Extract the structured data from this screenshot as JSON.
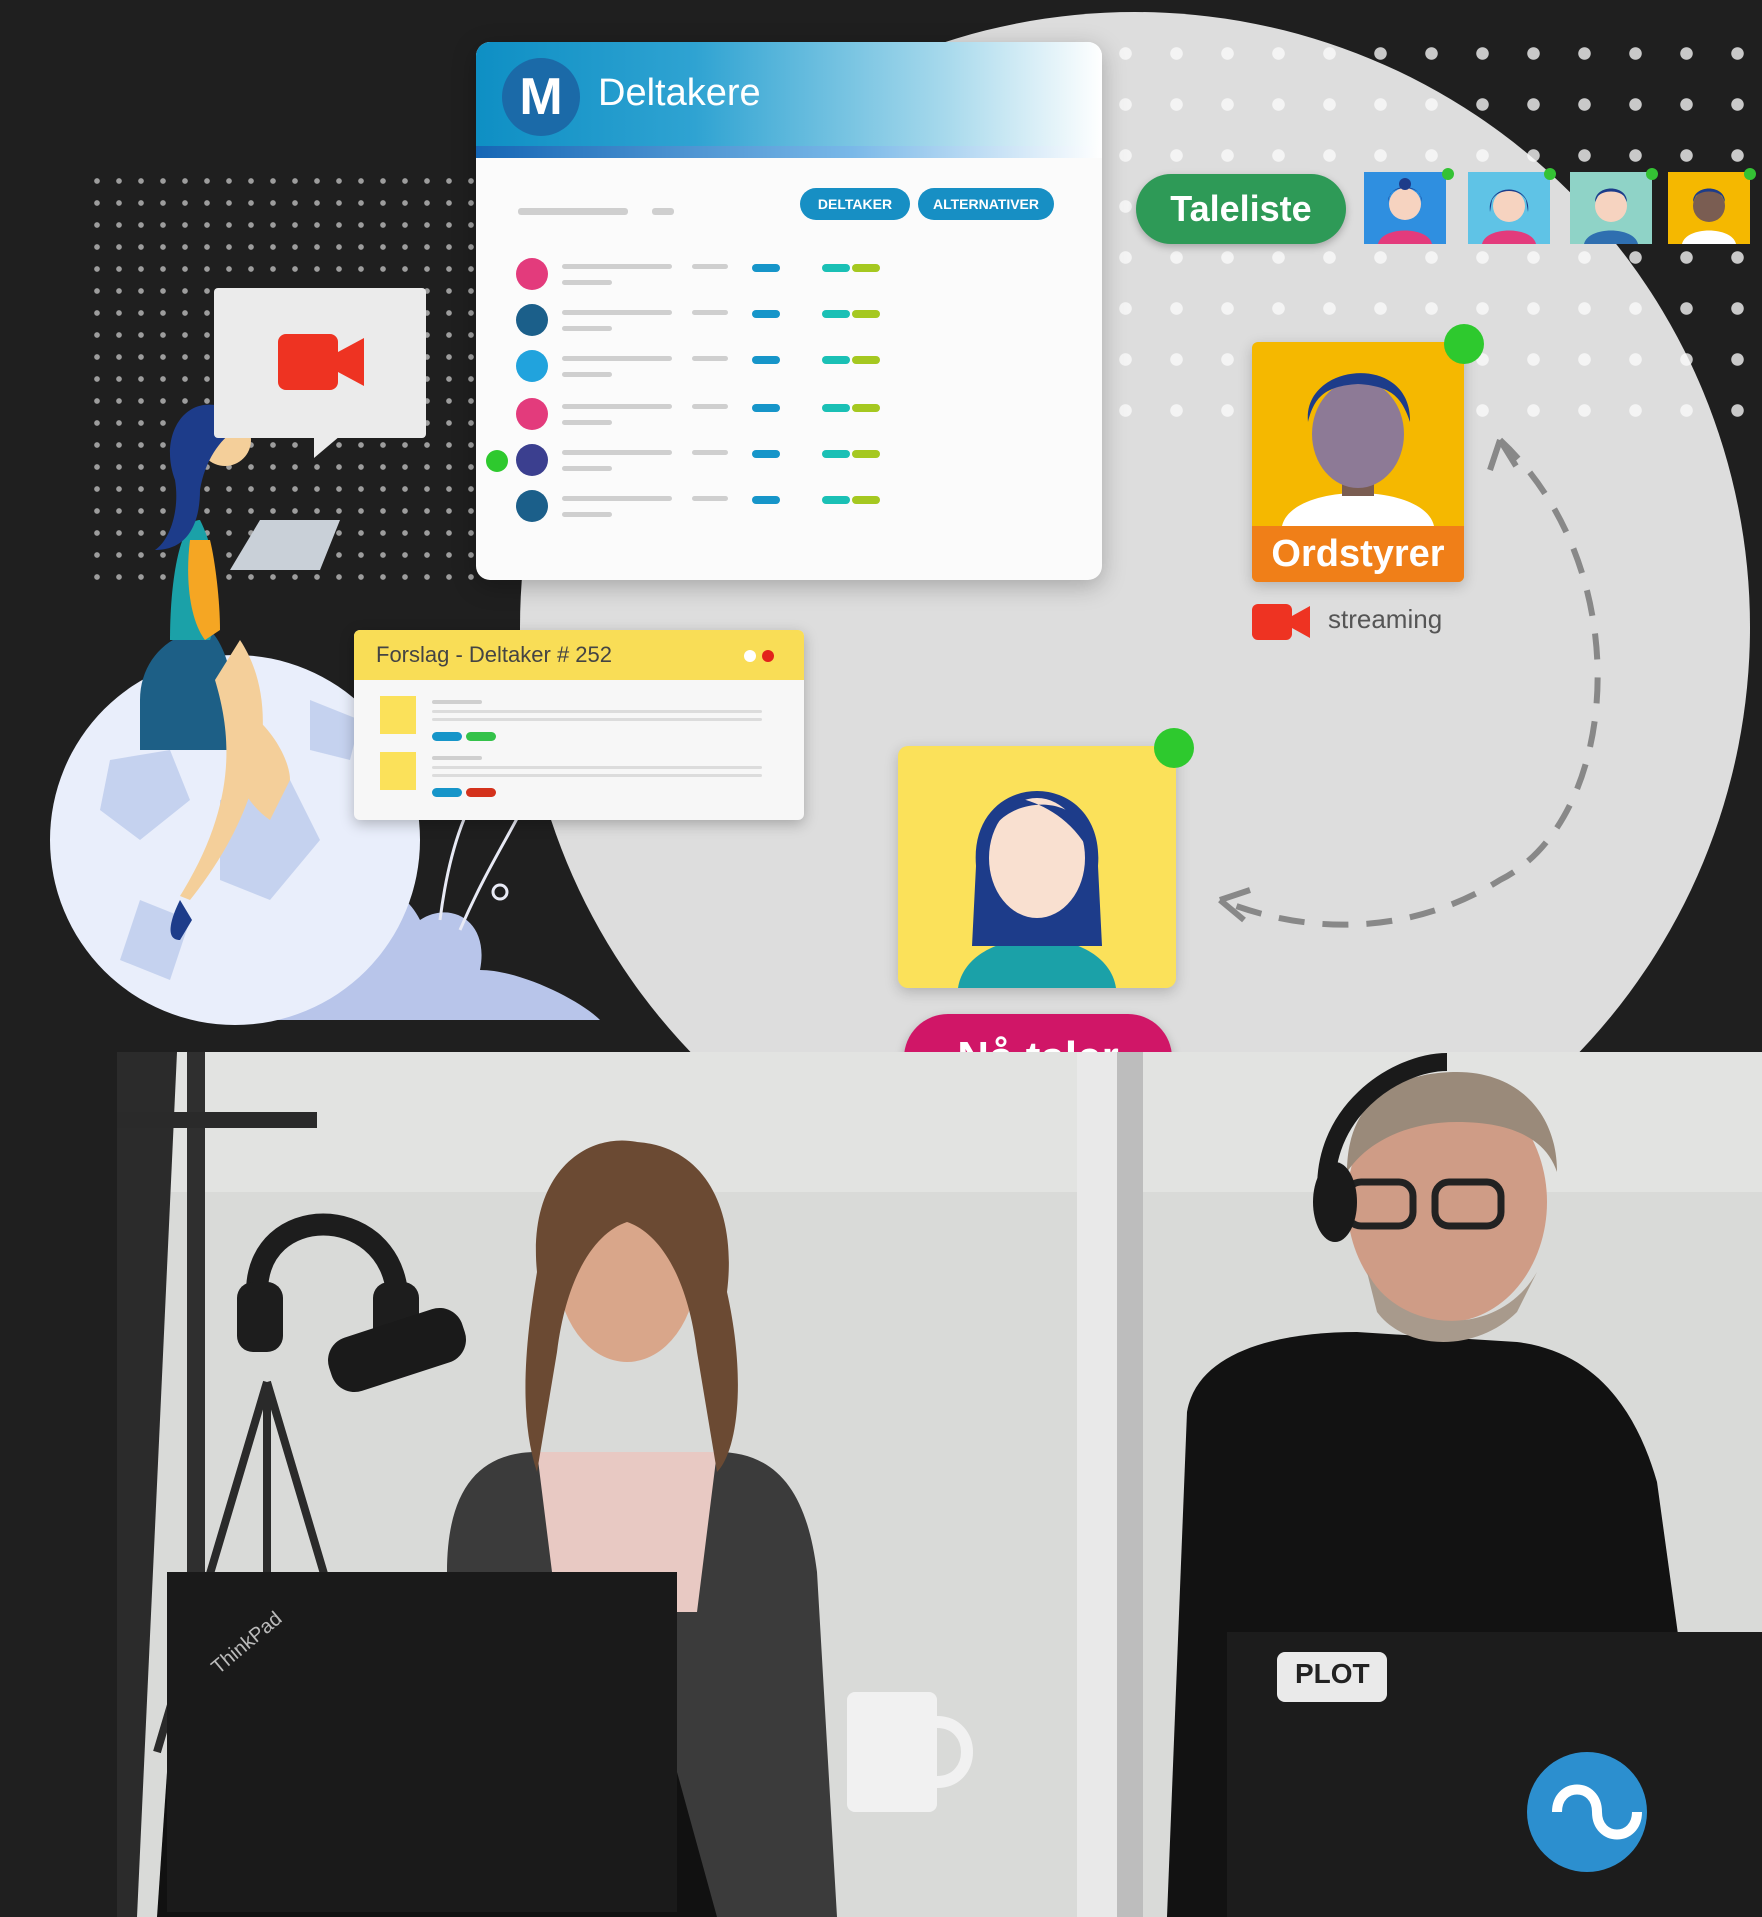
{
  "participants_panel": {
    "logo_letter": "M",
    "title": "Deltakere",
    "buttons": [
      "DELTAKER",
      "ALTERNATIVER"
    ],
    "row_count": 6
  },
  "speaker_list": {
    "label": "Taleliste",
    "queue_count": 4
  },
  "chair": {
    "label": "Ordstyrer",
    "status": "streaming"
  },
  "current_speaker": {
    "label": "Nå taler"
  },
  "proposal_card": {
    "title": "Forslag - Deltaker # 252"
  },
  "photo": {
    "laptop_brand_left": "ThinkPad",
    "sticker_text": "PLOT"
  },
  "colors": {
    "background": "#1f1f1f",
    "accent_blue": "#178fc4",
    "taleliste_green": "#2e9a57",
    "na_taler_pink": "#d01667",
    "ordstyrer_orange": "#f07f18",
    "online_green": "#2ec92e"
  }
}
